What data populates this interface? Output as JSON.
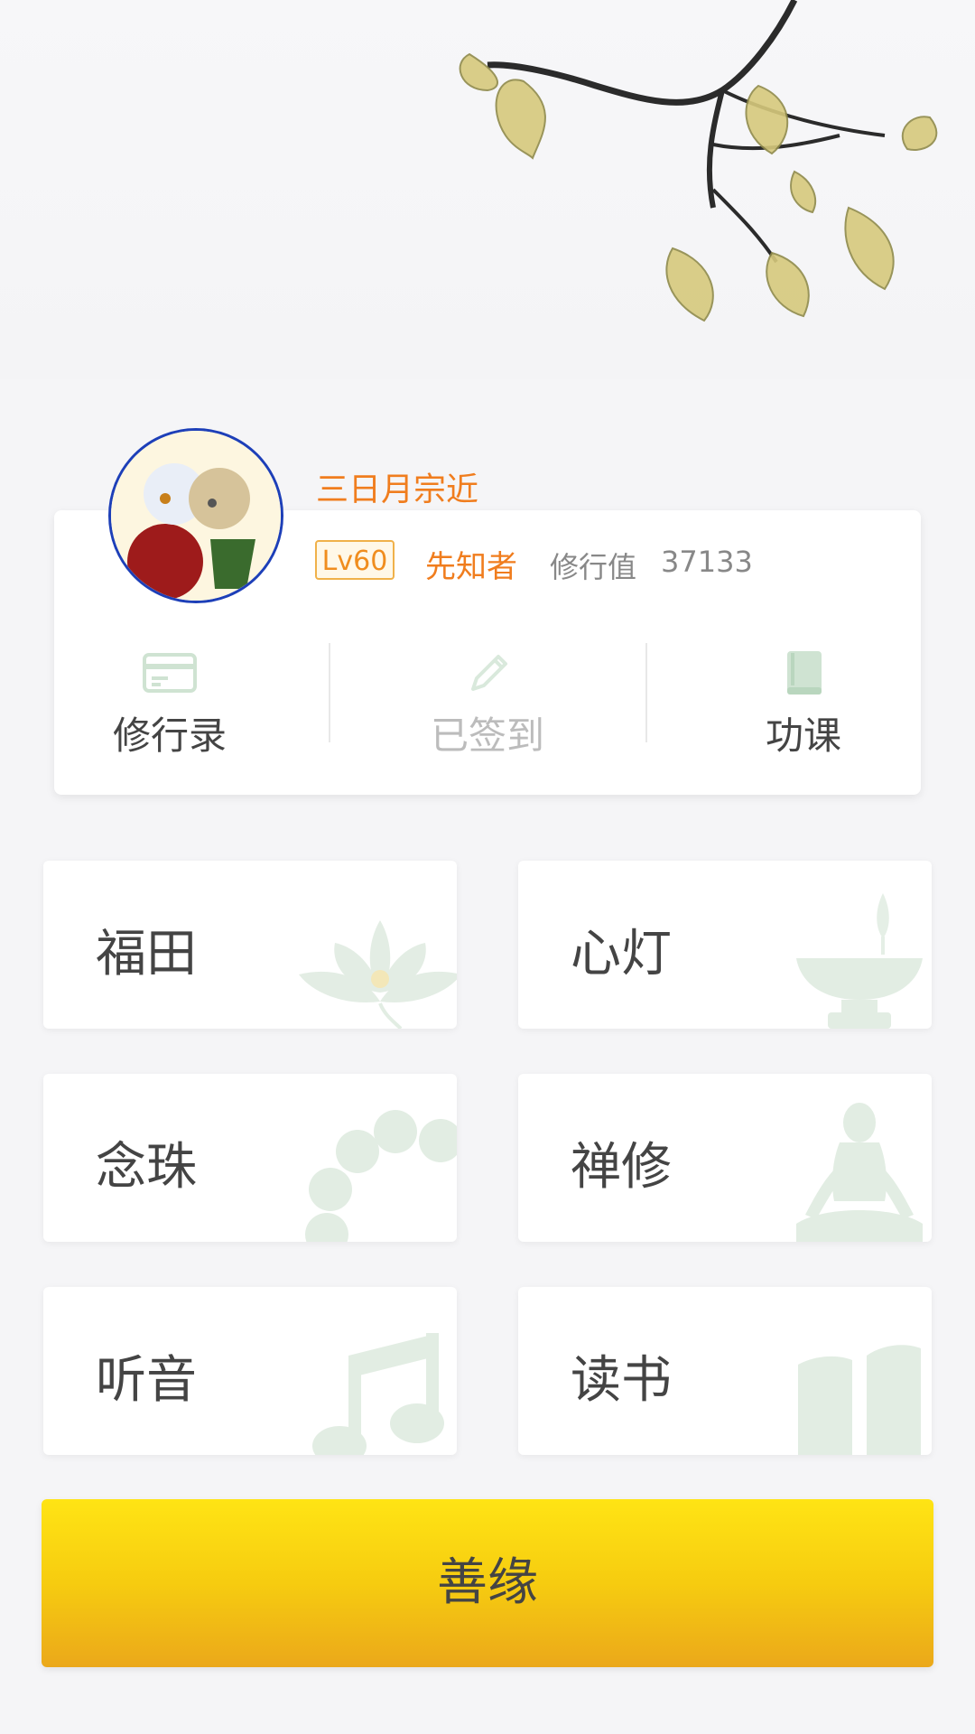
{
  "user": {
    "name": "三日月宗近",
    "level": "Lv60",
    "title": "先知者",
    "practice_label": "修行值",
    "practice_value": "37133"
  },
  "actions": [
    {
      "label": "修行录",
      "icon": "card-icon"
    },
    {
      "label": "已签到",
      "icon": "pencil-icon"
    },
    {
      "label": "功课",
      "icon": "book-icon"
    }
  ],
  "tiles": [
    {
      "label": "福田",
      "icon": "lotus-icon"
    },
    {
      "label": "心灯",
      "icon": "lamp-icon"
    },
    {
      "label": "念珠",
      "icon": "beads-icon"
    },
    {
      "label": "禅修",
      "icon": "meditation-icon"
    },
    {
      "label": "听音",
      "icon": "music-note-icon"
    },
    {
      "label": "读书",
      "icon": "open-book-icon"
    }
  ],
  "donate": {
    "label": "善缘"
  },
  "colors": {
    "accent": "#f07d1e",
    "button_top": "#ffe414",
    "button_bottom": "#eba81a",
    "icon_green": "#cfe3d2"
  }
}
